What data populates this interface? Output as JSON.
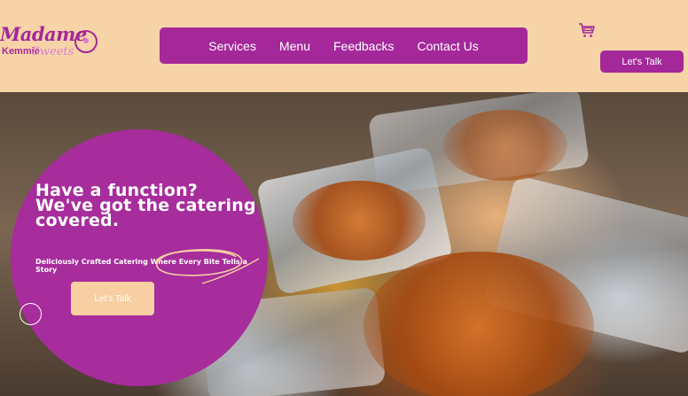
{
  "header": {
    "logo": {
      "line1": "Madame",
      "line2": "Kemmie",
      "line3": "Sweets"
    },
    "nav": [
      {
        "label": "Services"
      },
      {
        "label": "Menu"
      },
      {
        "label": "Feedbacks"
      },
      {
        "label": "Contact Us"
      }
    ],
    "cart_icon": "shopping-cart-icon",
    "cta_label": "Let's Talk"
  },
  "hero": {
    "title": "Have a function?\nWe've got the catering\ncovered.",
    "subtitle": "Deliciously Crafted Catering Where Every Bite Tells a Story",
    "cta_label": "Let's Talk"
  },
  "colors": {
    "brand_purple": "#a4289a",
    "header_bg": "#f7d4a7",
    "hero_button": "#f7cfa2"
  }
}
